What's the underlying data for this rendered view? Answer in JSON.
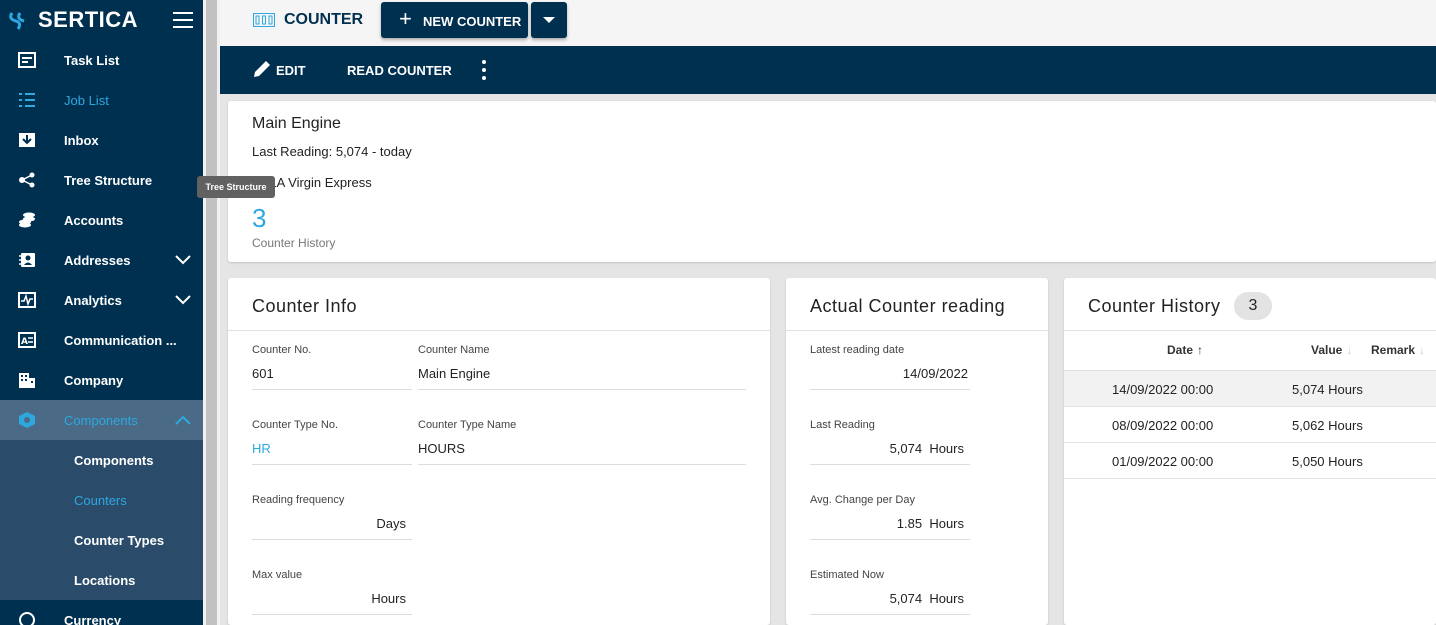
{
  "brand": {
    "name": "SERTICA"
  },
  "sidebar": {
    "items": [
      {
        "label": "Task List"
      },
      {
        "label": "Job List"
      },
      {
        "label": "Inbox"
      },
      {
        "label": "Tree Structure"
      },
      {
        "label": "Accounts"
      },
      {
        "label": "Addresses"
      },
      {
        "label": "Analytics"
      },
      {
        "label": "Communication ..."
      },
      {
        "label": "Company"
      },
      {
        "label": "Components"
      }
    ],
    "sub_items": [
      {
        "label": "Components"
      },
      {
        "label": "Counters"
      },
      {
        "label": "Counter Types"
      },
      {
        "label": "Locations"
      }
    ],
    "next_item": {
      "label": "Currency"
    }
  },
  "tooltip": "Tree Structure",
  "header": {
    "title": "COUNTER",
    "new_button": "NEW COUNTER"
  },
  "actions": {
    "edit": "EDIT",
    "read": "READ COUNTER"
  },
  "summary": {
    "name": "Main Engine",
    "last_reading": "Last Reading: 5,074 - today",
    "vessel": "BELA Virgin Express",
    "history_count": "3",
    "history_label": "Counter History"
  },
  "info": {
    "title": "Counter Info",
    "counter_no_label": "Counter No.",
    "counter_no": "601",
    "counter_name_label": "Counter Name",
    "counter_name": "Main Engine",
    "type_no_label": "Counter Type No.",
    "type_no": "HR",
    "type_name_label": "Counter Type Name",
    "type_name": "HOURS",
    "freq_label": "Reading frequency",
    "freq": "Days",
    "max_label": "Max value",
    "max": "Hours"
  },
  "actual": {
    "title": "Actual Counter reading",
    "latest_label": "Latest reading date",
    "latest": "14/09/2022",
    "last_label": "Last Reading",
    "last": "5,074  Hours",
    "avg_label": "Avg. Change per Day",
    "avg": "1.85  Hours",
    "est_label": "Estimated Now",
    "est": "5,074  Hours"
  },
  "history": {
    "title": "Counter History",
    "count": "3",
    "columns": {
      "date": "Date",
      "value": "Value",
      "remark": "Remark"
    },
    "rows": [
      {
        "date": "14/09/2022 00:00",
        "value": "5,074 Hours"
      },
      {
        "date": "08/09/2022 00:00",
        "value": "5,062 Hours"
      },
      {
        "date": "01/09/2022 00:00",
        "value": "5,050 Hours"
      }
    ]
  },
  "colors": {
    "navy": "#003050",
    "accent": "#2ea8e0"
  }
}
